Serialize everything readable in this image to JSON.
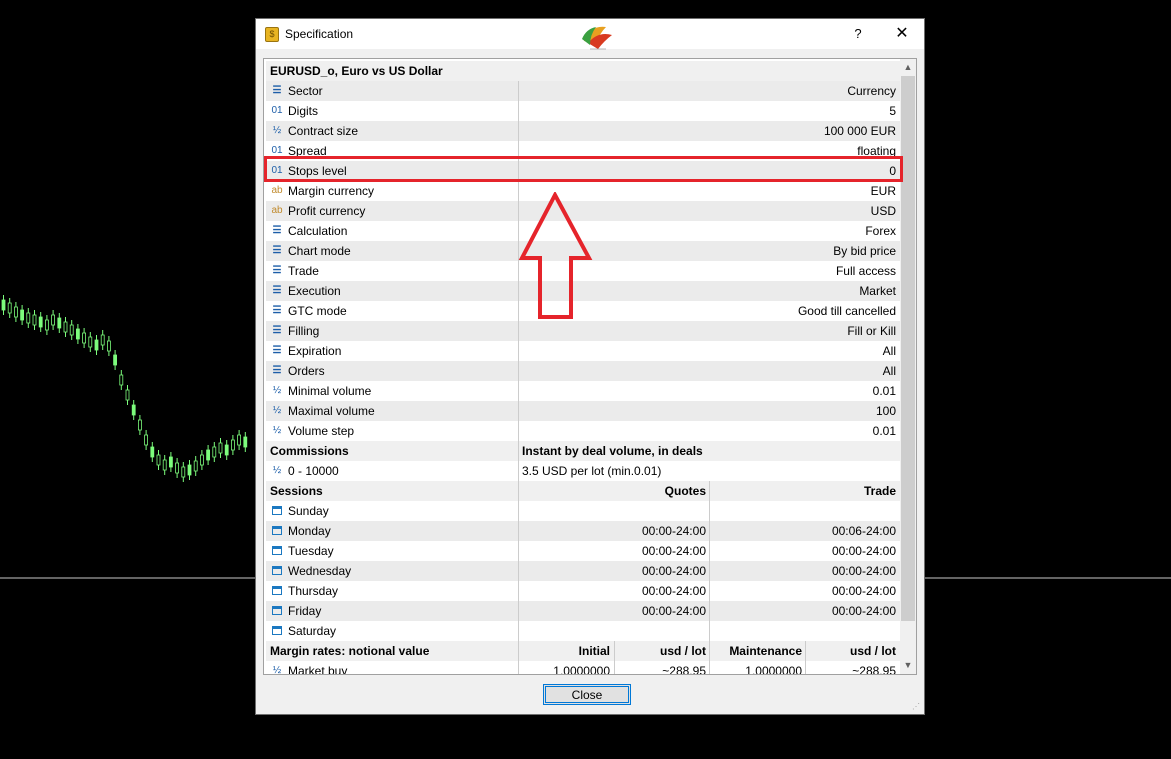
{
  "window": {
    "title": "Specification",
    "help_symbol": "?",
    "close_symbol": "✕",
    "close_button_label": "Close"
  },
  "symbol_header": "EURUSD_o, Euro vs US Dollar",
  "properties": [
    {
      "icon": "list-icon",
      "label": "Sector",
      "value": "Currency"
    },
    {
      "icon": "digits-icon",
      "label": "Digits",
      "value": "5"
    },
    {
      "icon": "fraction-icon",
      "label": "Contract size",
      "value": "100 000 EUR"
    },
    {
      "icon": "digits-icon",
      "label": "Spread",
      "value": "floating"
    },
    {
      "icon": "digits-icon",
      "label": "Stops level",
      "value": "0"
    },
    {
      "icon": "text-icon",
      "label": "Margin currency",
      "value": "EUR"
    },
    {
      "icon": "text-icon",
      "label": "Profit currency",
      "value": "USD"
    },
    {
      "icon": "list-icon",
      "label": "Calculation",
      "value": "Forex"
    },
    {
      "icon": "list-icon",
      "label": "Chart mode",
      "value": "By bid price"
    },
    {
      "icon": "list-icon",
      "label": "Trade",
      "value": "Full access"
    },
    {
      "icon": "list-icon",
      "label": "Execution",
      "value": "Market"
    },
    {
      "icon": "list-icon",
      "label": "GTC mode",
      "value": "Good till cancelled"
    },
    {
      "icon": "list-icon",
      "label": "Filling",
      "value": "Fill or Kill"
    },
    {
      "icon": "list-icon",
      "label": "Expiration",
      "value": "All"
    },
    {
      "icon": "list-icon",
      "label": "Orders",
      "value": "All"
    },
    {
      "icon": "fraction-icon",
      "label": "Minimal volume",
      "value": "0.01"
    },
    {
      "icon": "fraction-icon",
      "label": "Maximal volume",
      "value": "100"
    },
    {
      "icon": "fraction-icon",
      "label": "Volume step",
      "value": "0.01"
    }
  ],
  "commissions": {
    "header": "Commissions",
    "header_value": "Instant by deal volume, in deals",
    "rows": [
      {
        "label": "0 - 10000",
        "value": "3.5 USD per lot (min.0.01)"
      }
    ]
  },
  "sessions": {
    "header": "Sessions",
    "col_quotes": "Quotes",
    "col_trade": "Trade",
    "days": [
      {
        "day": "Sunday",
        "quotes": "",
        "trade": ""
      },
      {
        "day": "Monday",
        "quotes": "00:00-24:00",
        "trade": "00:06-24:00"
      },
      {
        "day": "Tuesday",
        "quotes": "00:00-24:00",
        "trade": "00:00-24:00"
      },
      {
        "day": "Wednesday",
        "quotes": "00:00-24:00",
        "trade": "00:00-24:00"
      },
      {
        "day": "Thursday",
        "quotes": "00:00-24:00",
        "trade": "00:00-24:00"
      },
      {
        "day": "Friday",
        "quotes": "00:00-24:00",
        "trade": "00:00-24:00"
      },
      {
        "day": "Saturday",
        "quotes": "",
        "trade": ""
      }
    ]
  },
  "margin": {
    "header": "Margin rates: notional value",
    "col_initial": "Initial",
    "col_usd_lot_1": "usd / lot",
    "col_maintenance": "Maintenance",
    "col_usd_lot_2": "usd / lot",
    "rows": [
      {
        "label": "Market buy",
        "initial": "1.0000000",
        "usd1": "~288.95",
        "maintenance": "1.0000000",
        "usd2": "~288.95"
      }
    ]
  },
  "highlighted_row": "Stops level",
  "annotation_color": "#e5242b",
  "chart_background": {
    "candle_color": "#7cfc7c",
    "line_color": "#c8c8c8"
  }
}
